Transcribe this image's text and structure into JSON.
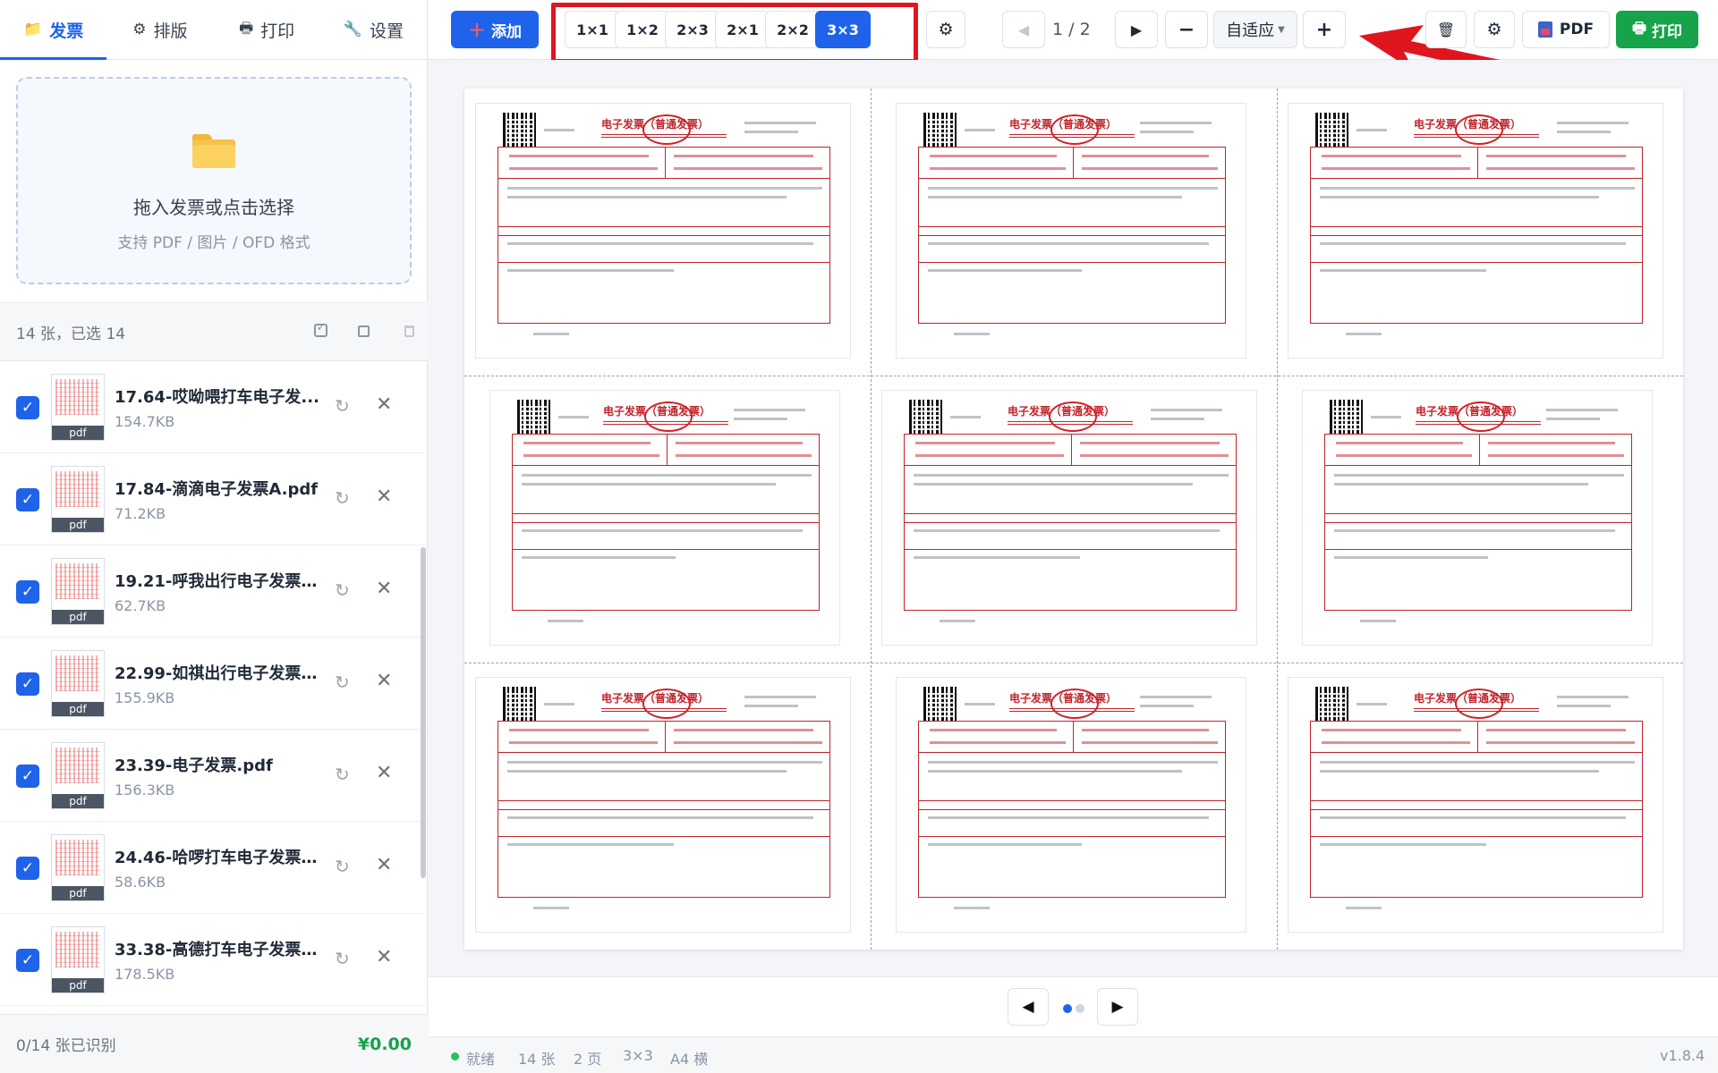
{
  "colors": {
    "accent": "#1e63e9",
    "success": "#16a34a",
    "highlight": "#e0161e",
    "invoice_red": "#c0242b"
  },
  "sidebar": {
    "tabs": [
      {
        "label": "发票",
        "icon": "folder-icon",
        "glyph": "📁",
        "active": true
      },
      {
        "label": "排版",
        "icon": "gear-icon",
        "glyph": "⚙",
        "active": false
      },
      {
        "label": "打印",
        "icon": "printer-icon",
        "glyph": "🖶",
        "active": false
      },
      {
        "label": "设置",
        "icon": "wrench-icon",
        "glyph": "🔧",
        "active": false
      }
    ],
    "dropzone": {
      "title": "拖入发票或点击选择",
      "subtitle": "支持 PDF / 图片 / OFD 格式"
    },
    "list_header": {
      "count_text": "14 张，已选 14"
    },
    "files": [
      {
        "name": "17.64-哎呦喂打车电子发...",
        "size": "154.7KB",
        "type": "pdf",
        "checked": true
      },
      {
        "name": "17.84-滴滴电子发票A.pdf",
        "size": "71.2KB",
        "type": "pdf",
        "checked": true
      },
      {
        "name": "19.21-呼我出行电子发票.pdf",
        "size": "62.7KB",
        "type": "pdf",
        "checked": true
      },
      {
        "name": "22.99-如祺出行电子发票....",
        "size": "155.9KB",
        "type": "pdf",
        "checked": true
      },
      {
        "name": "23.39-电子发票.pdf",
        "size": "156.3KB",
        "type": "pdf",
        "checked": true
      },
      {
        "name": "24.46-哈啰打车电子发票1....",
        "size": "58.6KB",
        "type": "pdf",
        "checked": true
      },
      {
        "name": "33.38-高德打车电子发票....",
        "size": "178.5KB",
        "type": "pdf",
        "checked": true
      }
    ],
    "footer": {
      "recognized": "0/14 张已识别",
      "total": "¥0.00"
    }
  },
  "toolbar": {
    "add_label": "添加",
    "layouts": [
      {
        "label": "1×1",
        "active": false
      },
      {
        "label": "1×2",
        "active": false
      },
      {
        "label": "2×3",
        "active": false
      },
      {
        "label": "2×1",
        "active": false
      },
      {
        "label": "2×2",
        "active": false
      },
      {
        "label": "3×3",
        "active": true
      }
    ],
    "page_indicator": "1 / 2",
    "zoom": "自适应",
    "pdf_label": "PDF",
    "print_label": "打印"
  },
  "preview": {
    "grid": "3×3",
    "invoice_title": "电子发票（普通发票）",
    "invoice_count_on_page": 9
  },
  "pager": {
    "current": 1,
    "total": 2
  },
  "statusbar": {
    "state": "就绪",
    "count": "14 张",
    "pages": "2 页",
    "layout": "3×3",
    "paper": "A4 横",
    "version": "v1.8.4"
  }
}
